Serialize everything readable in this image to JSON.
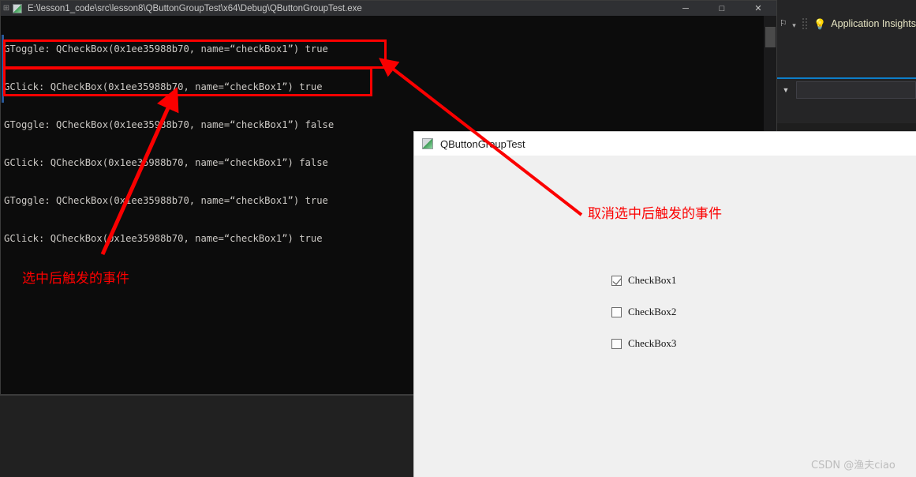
{
  "console_window": {
    "title": "E:\\lesson1_code\\src\\lesson8\\QButtonGroupTest\\x64\\Debug\\QButtonGroupTest.exe",
    "system_menu_icon": "system-menu-icon",
    "app_icon": "console-app-icon",
    "buttons": {
      "minimize": "─",
      "maximize": "□",
      "close": "✕"
    },
    "lines": [
      "GToggle: QCheckBox(0x1ee35988b70, name=“checkBox1”) true",
      "GClick: QCheckBox(0x1ee35988b70, name=“checkBox1”) true",
      "GToggle: QCheckBox(0x1ee35988b70, name=“checkBox1”) false",
      "GClick: QCheckBox(0x1ee35988b70, name=“checkBox1”) false",
      "GToggle: QCheckBox(0x1ee35988b70, name=“checkBox1”) true",
      "GClick: QCheckBox(0x1ee35988b70, name=“checkBox1”) true"
    ]
  },
  "vs_panel": {
    "scroll_up_glyph": "∧",
    "collapse_glyph": "❮",
    "flag_icon": "flag-icon",
    "dropdown_glyph": "▾",
    "grip_icon": "grip-dots-icon",
    "bulb_icon": "lightbulb-icon",
    "bulb_glyph": "💡",
    "app_insights_label": "Application Insights",
    "combo_arrow_glyph": "▼",
    "accent_color": "#0d7ec9"
  },
  "qt_window": {
    "title": "QButtonGroupTest",
    "icon": "qt-app-icon",
    "checkboxes": [
      {
        "label": "CheckBox1",
        "checked": true
      },
      {
        "label": "CheckBox2",
        "checked": false
      },
      {
        "label": "CheckBox3",
        "checked": false
      }
    ]
  },
  "annotations": {
    "color": "#fb0000",
    "label_checked": "选中后触发的事件",
    "label_unchecked": "取消选中后触发的事件"
  },
  "watermark": {
    "text": "CSDN @渔夫ciao"
  }
}
